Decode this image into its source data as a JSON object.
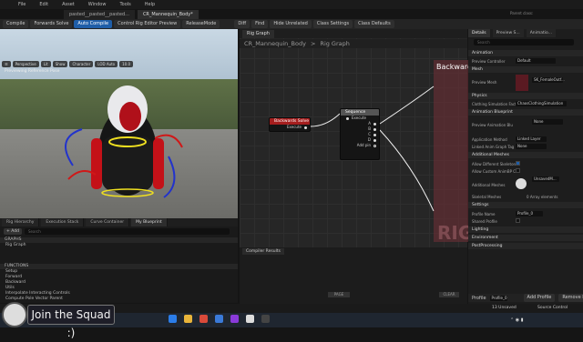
{
  "menubar": {
    "items": [
      "File",
      "Edit",
      "Asset",
      "Window",
      "Tools",
      "Help"
    ]
  },
  "doc_tabs": [
    "pasted__pasted__pasted...",
    "CR_Mannequin_Body*"
  ],
  "parent_class": "Parent class:",
  "toolbar": {
    "items": [
      "Compile",
      "Forwards Solve",
      "Auto Compile",
      "Control Rig Editor Preview",
      "ReleaseMode",
      "Diff",
      "Find",
      "Hide Unrelated",
      "Class Settings",
      "Class Defaults"
    ]
  },
  "viewport": {
    "buttons": [
      "Perspective",
      "Lit",
      "Show",
      "Character",
      "LOD Auto",
      "10.0"
    ],
    "label": "Previewing Reference Pose"
  },
  "views_tabs": [
    "Rig Hierarchy",
    "Execution Stack",
    "Curve Container",
    "My Blueprint"
  ],
  "my_blueprint": {
    "add": "+ Add",
    "search": "Search",
    "sections": [
      "GRAPHS",
      "FUNCTIONS"
    ],
    "graph_items": [
      "Rig Graph"
    ],
    "function_items": [
      "Setup",
      "Forward",
      "Backward",
      "Utils",
      "Interpolate Interacting Controls",
      "Compute Pole Vector Parent"
    ]
  },
  "graph": {
    "tab": "Rig Graph",
    "breadcrumb": [
      "CR_Mannequin_Body",
      ">",
      "Rig Graph"
    ],
    "backward_node": {
      "title": "Backwards Solve",
      "pin": "Execute"
    },
    "sequence_node": {
      "title": "Sequence",
      "pin": "Execute",
      "pins": [
        "A",
        "B",
        "C",
        "D"
      ],
      "add_pin": "Add pin"
    },
    "large_node_title": "Backward",
    "watermark": "RIG"
  },
  "compiler": {
    "tab": "Compiler Results",
    "page": "PAGE",
    "clear": "CLEAR"
  },
  "details": {
    "tabs": [
      "Details",
      "Preview S...",
      "Animatio..."
    ],
    "search": "Search",
    "categories": [
      "Animation",
      "Mesh",
      "Physics",
      "Animation Blueprint",
      "Additional Meshes",
      "Settings",
      "Lighting",
      "Environment",
      "PostProcessing"
    ],
    "props": {
      "preview_controller": "Preview Controller",
      "preview_controller_val": "Default",
      "preview_mesh": "Preview Mesh",
      "preview_mesh_val": "SK_FemaleOutf...",
      "cloth_sim": "Clothing Simulation Fact",
      "cloth_sim_val": "ChaosClothingSimulation",
      "preview_anim_bp": "Preview Animation Blu",
      "preview_anim_val": "None",
      "application_method": "Application Method",
      "application_method_val": "Linked Layer",
      "linked_anim_graph": "Linked Anim Graph Tag",
      "linked_anim_graph_val": "None",
      "allow_diff_skel": "Allow Different Skeleton",
      "allow_custom_anim": "Allow Custom AnimBP C",
      "additional_meshes": "Additional Meshes",
      "additional_meshes_val": "UnsavedM...",
      "skeletal_meshes": "Skeletal Meshes",
      "skeletal_meshes_val": "0 Array elements",
      "profile_name": "Profile Name",
      "profile_name_val": "Profile_0",
      "shared_profile": "Shared Profile"
    },
    "profile": "Profile",
    "profile_val": "Profile_0",
    "add_profile": "Add Profile",
    "remove_profile": "Remove Profile"
  },
  "status": {
    "unsaved": "13 Unsaved",
    "source_control": "Source Control"
  },
  "overlay": {
    "squad_text": "Join the Squad :)"
  },
  "accent": "#1f5ea8"
}
